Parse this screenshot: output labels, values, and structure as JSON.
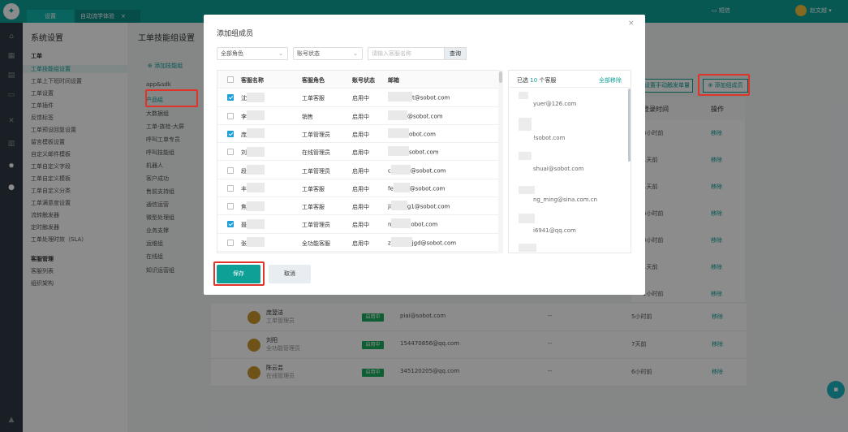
{
  "topbar": {
    "logo_icon": "tooth-logo",
    "tab_settings": "设置",
    "tab_workbench": "自动流学体验",
    "tab_close": "×",
    "right_msg": "短信",
    "right_user": "赵文越 ▾"
  },
  "settings": {
    "title": "系统设置",
    "group_ticket": "工单",
    "items": [
      "工单技能组设置",
      "工单上下班时间设置",
      "工单设置",
      "工单插件",
      "反馈标签",
      "工单预设回复设置",
      "留言模板设置",
      "自定义邮件模板",
      "工单自定义字段",
      "工单自定义模板",
      "工单自定义分类",
      "工单满意度设置",
      "流转触发器",
      "定时触发器",
      "工单处理时效（SLA）"
    ],
    "group_service": "客服管理",
    "service_items": [
      "客服列表",
      "组织架构"
    ]
  },
  "main": {
    "title": "工单技能组设置",
    "add_group": "⊕ 添加技能组",
    "groups": [
      "app&sdk",
      "产品组",
      "大数据组",
      "工单-族栓-大屏",
      "呼叫工单专员",
      "呼叫技能组",
      "机器人",
      "客户成功",
      "售前支持组",
      "通信运营",
      "微型处理组",
      "业务支撑",
      "运维组",
      "在线组",
      "知识运营组"
    ],
    "btn_manual": "设置手动触发单量",
    "btn_add_member": "⊕ 添加组成员",
    "header_last_login": "登录时间",
    "header_op": "操作",
    "bg_times": [
      "3小时前",
      "1天前",
      "1天前",
      "4小时前",
      "3小时前",
      "1天前",
      "1小时前"
    ],
    "bg_rows": [
      {
        "name": "庞翌洁",
        "role": "工单管理员",
        "status": "启用中",
        "email": "piai@sobot.com",
        "dash": "--",
        "time": "5小时前",
        "op": "移除"
      },
      {
        "name": "刘阳",
        "role": "全功能管理员",
        "status": "启用中",
        "email": "154470856@qq.com",
        "dash": "--",
        "time": "7天前",
        "op": "移除"
      },
      {
        "name": "陈云芸",
        "role": "在线管理员",
        "status": "启用中",
        "email": "345120205@qq.com",
        "dash": "--",
        "time": "6小时前",
        "op": "移除"
      }
    ],
    "op_text": "移除"
  },
  "modal": {
    "title": "添加组成员",
    "close": "×",
    "filter_role": "全部角色",
    "filter_status": "账号状态",
    "search_placeholder": "请输入客服名称",
    "search_btn": "查询",
    "head": {
      "name": "客服名称",
      "role": "客服角色",
      "status": "账号状态",
      "email": "邮箱"
    },
    "rows": [
      {
        "checked": true,
        "name": "沈",
        "role": "工单客服",
        "status": "启用中",
        "email_a": "",
        "email_b": "t@sobot.com"
      },
      {
        "checked": false,
        "name": "李",
        "role": "销售",
        "status": "启用中",
        "email_a": "",
        "email_b": "@sobot.com"
      },
      {
        "checked": true,
        "name": "庞",
        "role": "工单管理员",
        "status": "启用中",
        "email_a": "",
        "email_b": "obot.com"
      },
      {
        "checked": false,
        "name": "刘",
        "role": "在线管理员",
        "status": "启用中",
        "email_a": "",
        "email_b": "sobot.com"
      },
      {
        "checked": false,
        "name": "段",
        "role": "工单管理员",
        "status": "启用中",
        "email_a": "c",
        "email_b": "@sobot.com"
      },
      {
        "checked": false,
        "name": "丰",
        "role": "工单客服",
        "status": "启用中",
        "email_a": "fe",
        "email_b": "@sobot.com"
      },
      {
        "checked": false,
        "name": "焦",
        "role": "工单客服",
        "status": "启用中",
        "email_a": "ji",
        "email_b": "g1@sobot.com"
      },
      {
        "checked": true,
        "name": "聂",
        "role": "工单管理员",
        "status": "启用中",
        "email_a": "n",
        "email_b": "obot.com"
      },
      {
        "checked": false,
        "name": "张",
        "role": "全功能客服",
        "status": "启用中",
        "email_a": "z",
        "email_b": "jgd@sobot.com"
      }
    ],
    "selected_prefix": "已选",
    "selected_count": "10",
    "selected_suffix": "个客服",
    "remove_all": "全部移除",
    "selected": [
      {
        "n": "",
        "e": "yuer@126.com"
      },
      {
        "n": "",
        "e": "!sobot.com"
      },
      {
        "n": "",
        "e": "shuai@sobot.com"
      },
      {
        "n": "",
        "e": "ng_ming@sina.com.cn"
      },
      {
        "n": "",
        "e": "i6941@qq.com"
      }
    ],
    "btn_save": "保存",
    "btn_cancel": "取消"
  }
}
